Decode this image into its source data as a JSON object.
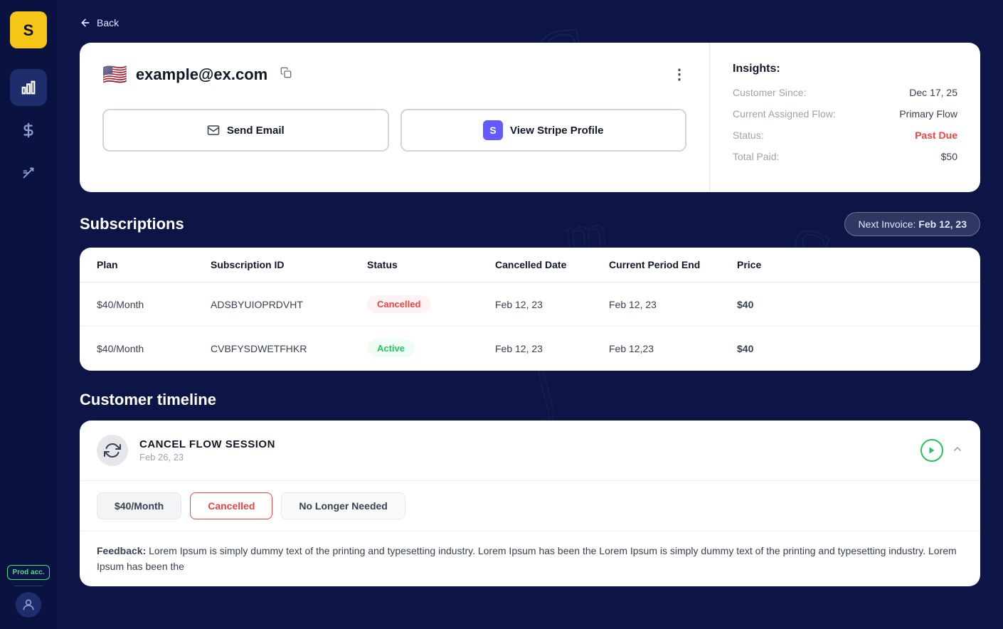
{
  "sidebar": {
    "logo_text": "S",
    "prod_badge": "Prod acc.",
    "icons": [
      {
        "name": "analytics-icon",
        "symbol": "📊",
        "active": true
      },
      {
        "name": "billing-icon",
        "symbol": "💲",
        "active": false
      },
      {
        "name": "magic-icon",
        "symbol": "✨",
        "active": false
      }
    ]
  },
  "back_label": "Back",
  "customer": {
    "flag": "🇺🇸",
    "email": "example@ex.com",
    "insights": {
      "title": "Insights:",
      "rows": [
        {
          "label": "Customer Since:",
          "value": "Dec 17, 25",
          "class": ""
        },
        {
          "label": "Current Assigned Flow:",
          "value": "Primary Flow",
          "class": ""
        },
        {
          "label": "Status:",
          "value": "Past Due",
          "class": "past-due"
        },
        {
          "label": "Total Paid:",
          "value": "$50",
          "class": ""
        }
      ]
    }
  },
  "actions": {
    "send_email": "Send Email",
    "view_stripe": "View Stripe Profile",
    "stripe_letter": "S"
  },
  "subscriptions": {
    "title": "Subscriptions",
    "next_invoice_label": "Next Invoice:",
    "next_invoice_date": "Feb 12, 23",
    "columns": [
      "Plan",
      "Subscription ID",
      "Status",
      "Cancelled Date",
      "Current Period End",
      "Price"
    ],
    "rows": [
      {
        "plan": "$40/Month",
        "id": "ADSBYUIOPRDVHT",
        "status": "Cancelled",
        "status_class": "status-cancelled",
        "cancelled_date": "Feb 12, 23",
        "period_end": "Feb 12, 23",
        "price": "$40"
      },
      {
        "plan": "$40/Month",
        "id": "CVBFYSDWETFHKR",
        "status": "Active",
        "status_class": "status-active",
        "cancelled_date": "Feb 12, 23",
        "period_end": "Feb 12,23",
        "price": "$40"
      }
    ]
  },
  "timeline": {
    "title": "Customer timeline",
    "session": {
      "icon": "🔄",
      "title": "CANCEL FLOW SESSION",
      "date": "Feb 26, 23"
    },
    "tags": [
      {
        "label": "$40/Month",
        "class": "tag-grey"
      },
      {
        "label": "Cancelled",
        "class": "tag-red"
      },
      {
        "label": "No Longer Needed",
        "class": "tag-lightgrey"
      }
    ],
    "feedback_label": "Feedback:",
    "feedback_text": "Lorem Ipsum is simply dummy text of the printing and typesetting industry. Lorem Ipsum has been the Lorem Ipsum is simply dummy text of the printing and typesetting industry. Lorem Ipsum has been the"
  }
}
